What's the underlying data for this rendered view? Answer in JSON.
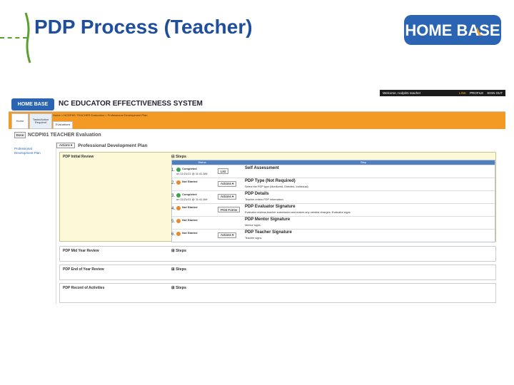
{
  "slide": {
    "title": "PDP Process (Teacher)"
  },
  "logo": {
    "text": "HOME BASE",
    "color": "#2a64b2"
  },
  "app": {
    "topbar": {
      "welcome": "Welcome, ncdpi01 teacher",
      "links": [
        "LINK",
        "PROFILE",
        "SIGN OUT"
      ]
    },
    "mini_logo": "HOME BASE",
    "system_title": "NC EDUCATOR EFFECTIVENESS SYSTEM",
    "tabs": [
      {
        "label": "Home"
      },
      {
        "label": "Tasks/Action Required"
      },
      {
        "label": "Evaluations"
      }
    ],
    "breadcrumb": "Home > NCDPI01 TEACHER Evaluation > Professional Development Plan",
    "done_label": "Done",
    "eval_title": "NCDPI01 TEACHER Evaluation",
    "sidebar_link": "Professional Development Plan",
    "actions_label": "Actions ▾",
    "panel_title": "Professional Development Plan",
    "sections": [
      {
        "label": "PDP Initial Review",
        "steps_label": "Steps",
        "open": true
      },
      {
        "label": "PDP Mid Year Review",
        "steps_label": "Steps",
        "open": false
      },
      {
        "label": "PDP End of Year Review",
        "steps_label": "Steps",
        "open": false
      },
      {
        "label": "PDP Record of Activities",
        "steps_label": "Steps",
        "open": false
      }
    ],
    "table_headers": {
      "status": "Status",
      "step": "Step"
    },
    "steps": [
      {
        "num": "1.",
        "status": "Completed",
        "date": "on 11/21/11 @ 11:41 AM",
        "color": "green",
        "action": "List",
        "title": "Self Assessment",
        "desc": ""
      },
      {
        "num": "2.",
        "status": "Not Started",
        "date": "",
        "color": "orange",
        "action": "Actions ▾",
        "title": "PDP Type (Not Required)",
        "desc": "Select the PDP type (Monitored, Directed, Individual)"
      },
      {
        "num": "3.",
        "status": "Completed",
        "date": "on 11/21/11 @ 11:41 AM",
        "color": "green",
        "action": "Actions ▾",
        "title": "PDP Details",
        "desc": "Teacher enters PDP information"
      },
      {
        "num": "4.",
        "status": "Not Started",
        "date": "",
        "color": "orange",
        "action": "Print Forms",
        "title": "PDP Evaluator Signature",
        "desc": "Evaluator reviews teacher submission and makes any needed changes. Evaluator signs"
      },
      {
        "num": "5.",
        "status": "Not Started",
        "date": "",
        "color": "orange",
        "action": "",
        "title": "PDP Mentor Signature",
        "desc": "Mentor signs"
      },
      {
        "num": "6.",
        "status": "Not Started",
        "date": "",
        "color": "orange",
        "action": "Actions ▾",
        "title": "PDP Teacher Signature",
        "desc": "Teacher signs"
      }
    ]
  }
}
